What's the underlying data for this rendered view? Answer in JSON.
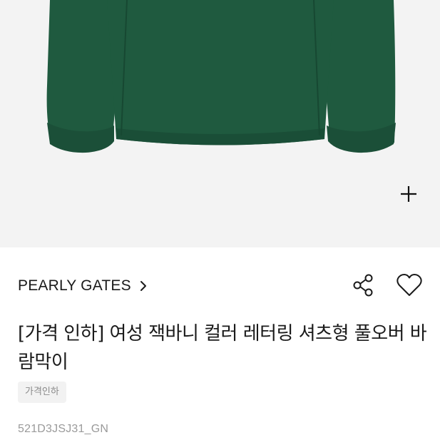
{
  "product": {
    "image_alt": "green pullover jacket",
    "zoom_icon": "plus-icon",
    "colors": {
      "jacket": "#1f5a3f",
      "jacket_shadow": "#174832",
      "background": "#f3f3f3"
    }
  },
  "brand": {
    "name": "PEARLY GATES",
    "chevron_icon": "chevron-right-icon"
  },
  "actions": {
    "share_icon": "share-icon",
    "like_icon": "heart-icon"
  },
  "title": "[가격 인하] 여성 잭바니 컬러 레터링 셔츠형 풀오버 바람막이",
  "tag": "가격인하",
  "code": "521D3JSJ31_GN"
}
